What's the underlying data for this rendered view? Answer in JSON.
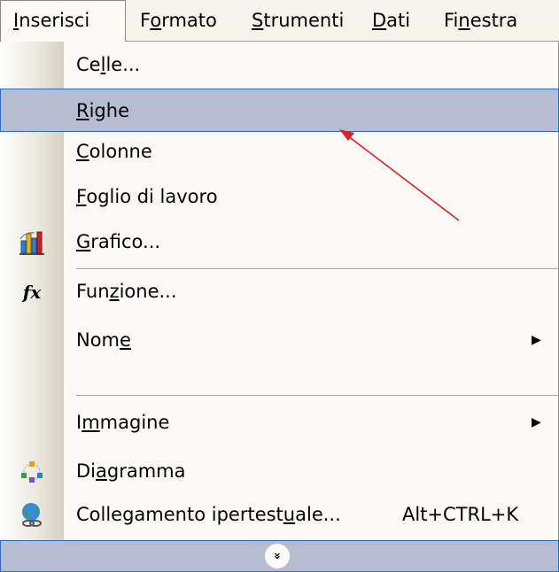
{
  "menubar": [
    {
      "before": "",
      "key": "I",
      "after": "nserisci"
    },
    {
      "before": "F",
      "key": "o",
      "after": "rmato"
    },
    {
      "before": "",
      "key": "S",
      "after": "trumenti"
    },
    {
      "before": "",
      "key": "D",
      "after": "ati"
    },
    {
      "before": "Fi",
      "key": "n",
      "after": "estra"
    }
  ],
  "items": [
    {
      "before": "Ce",
      "key": "l",
      "after": "le..."
    },
    {
      "before": "",
      "key": "R",
      "after": "ighe"
    },
    {
      "before": "",
      "key": "C",
      "after": "olonne"
    },
    {
      "before": "",
      "key": "F",
      "after": "oglio di lavoro"
    },
    {
      "before": "",
      "key": "G",
      "after": "rafico..."
    },
    {
      "before": "Fun",
      "key": "z",
      "after": "ione..."
    },
    {
      "before": "Nom",
      "key": "e",
      "after": ""
    },
    {
      "before": "I",
      "key": "m",
      "after": "magine"
    },
    {
      "before": "Di",
      "key": "a",
      "after": "gramma"
    },
    {
      "before": "Collegamento ipertest",
      "key": "u",
      "after": "ale...",
      "shortcut": "Alt+CTRL+K"
    }
  ],
  "expand_symbol": "»",
  "icons": {
    "chart": "chart-icon",
    "function": "function-icon",
    "function_glyph": "fx",
    "diagram": "diagram-icon",
    "hyperlink": "hyperlink-icon",
    "submenu": "submenu-arrow-icon",
    "expand": "expand-menu-icon"
  },
  "colors": {
    "menu_bg": "#fbfaf6",
    "highlight_bg": "#b6bdd2",
    "highlight_border": "#316ac5",
    "annotation_arrow": "#e02020"
  }
}
